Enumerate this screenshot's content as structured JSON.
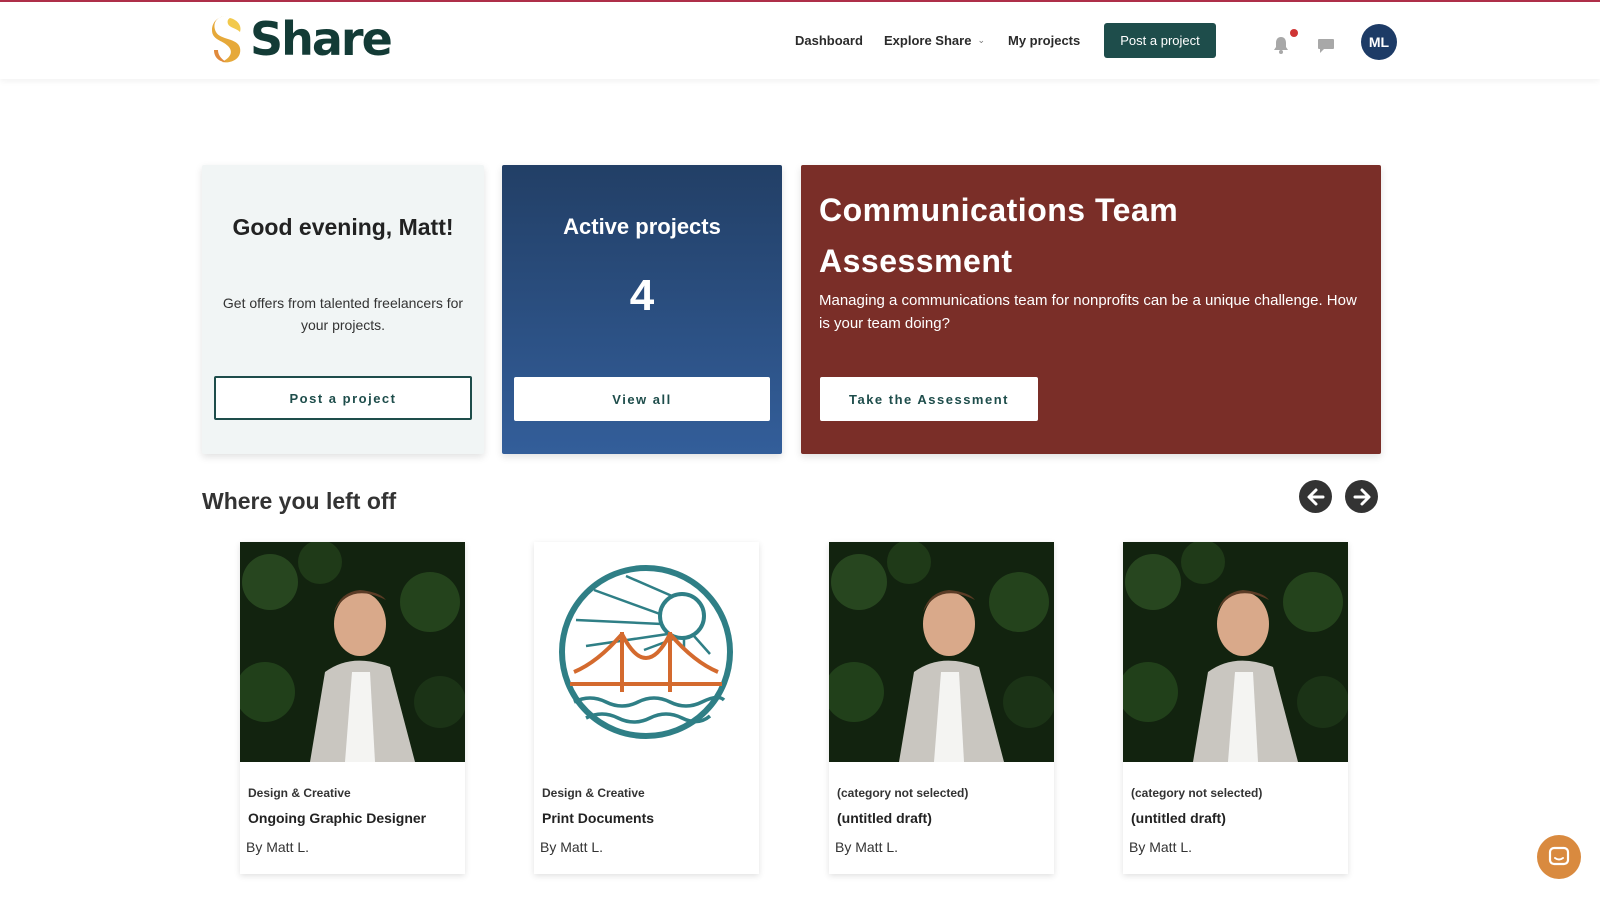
{
  "header": {
    "brand": "Share",
    "nav": {
      "dashboard": "Dashboard",
      "explore": "Explore Share",
      "my_projects": "My projects"
    },
    "post_button": "Post a project",
    "avatar_initials": "ML",
    "icons": [
      "bell-icon",
      "chat-icon",
      "chevron-down-icon"
    ]
  },
  "greeting_card": {
    "title": "Good evening, Matt!",
    "subtitle": "Get offers from talented freelancers for your projects.",
    "button": "Post a project"
  },
  "active_card": {
    "title": "Active projects",
    "count": "4",
    "button": "View all"
  },
  "assessment_card": {
    "title": "Communications Team Assessment",
    "subtitle": "Managing a communications team for nonprofits can be a unique challenge. How is your team doing?",
    "button": "Take the Assessment"
  },
  "recent": {
    "title": "Where you left off",
    "items": [
      {
        "category": "Design & Creative",
        "name": "Ongoing Graphic Designer",
        "by": "By Matt L.",
        "image": "profile-photo"
      },
      {
        "category": "Design & Creative",
        "name": "Print Documents",
        "by": "By Matt L.",
        "image": "bridge-logo"
      },
      {
        "category": "(category not selected)",
        "name": "(untitled draft)",
        "by": "By Matt L.",
        "image": "profile-photo"
      },
      {
        "category": "(category not selected)",
        "name": "(untitled draft)",
        "by": "By Matt L.",
        "image": "profile-photo"
      }
    ]
  },
  "colors": {
    "brand_green": "#1e4d4b",
    "active_blue": "#2a4c80",
    "assessment_red": "#7a2e28",
    "avatar_navy": "#1d3b66",
    "chat_orange": "#d98a3f"
  }
}
